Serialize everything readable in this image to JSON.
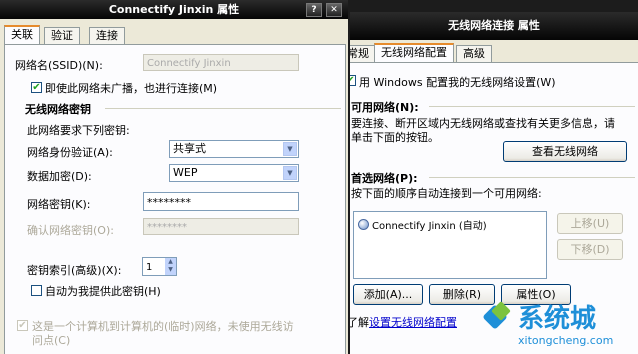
{
  "left_window": {
    "title": "Connectify Jinxin 属性",
    "tabs": [
      "关联",
      "验证",
      "连接"
    ],
    "ssid_label": "网络名(SSID)(N):",
    "ssid_value": "Connectify Jinxin",
    "broadcast_checkbox_label": "即使此网络未广播，也进行连接(M)",
    "group_title": "无线网络密钥",
    "group_desc": "此网络要求下列密钥:",
    "auth_label": "网络身份验证(A):",
    "auth_value": "共享式",
    "encryption_label": "数据加密(D):",
    "encryption_value": "WEP",
    "key_label": "网络密钥(K):",
    "key_value": "********",
    "confirm_key_label": "确认网络密钥(O):",
    "confirm_key_value": "********",
    "key_index_label": "密钥索引(高级)(X):",
    "key_index_value": "1",
    "auto_key_label": "自动为我提供此密钥(H)",
    "adhoc_label_line1": "这是一个计算机到计算机的(临时)网络，未使用无线访",
    "adhoc_label_line2": "问点(C)"
  },
  "right_window": {
    "title": "无线网络连接 属性",
    "tabs": [
      "常规",
      "无线网络配置",
      "高级"
    ],
    "use_windows_label": "用 Windows 配置我的无线网络设置(W)",
    "available_title": "可用网络(N):",
    "available_desc_line1": "要连接、断开区域内无线网络或查找有关更多信息，请",
    "available_desc_line2": "单击下面的按钮。",
    "view_networks_button": "查看无线网络",
    "preferred_title": "首选网络(P):",
    "preferred_desc": "按下面的顺序自动连接到一个可用网络:",
    "preferred_networks": [
      "Connectify Jinxin (自动)"
    ],
    "move_up_button": "上移(U)",
    "move_down_button": "下移(D)",
    "add_button": "添加(A)...",
    "remove_button": "删除(R)",
    "properties_button": "属性(O)",
    "learn_prefix": "了解",
    "learn_link": "设置无线网络配置"
  },
  "watermark": {
    "brand": "系统城",
    "url": "xitongcheng.com"
  }
}
